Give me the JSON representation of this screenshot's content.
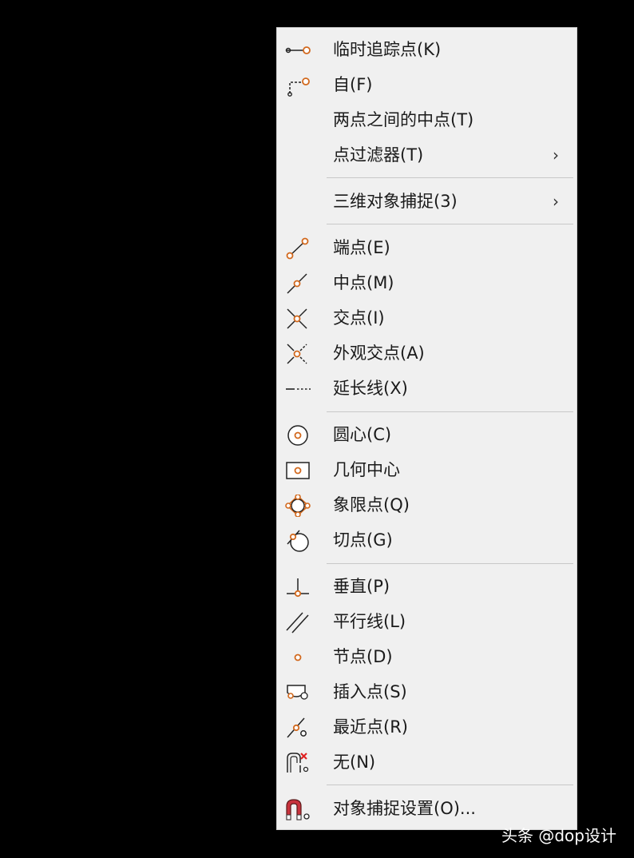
{
  "menu": {
    "items": [
      {
        "label": "临时追踪点(K)",
        "icon": "temporary-track-point-icon"
      },
      {
        "label": "自(F)",
        "icon": "from-icon"
      },
      {
        "label": "两点之间的中点(T)",
        "icon": ""
      },
      {
        "label": "点过滤器(T)",
        "icon": "",
        "submenu": "›"
      },
      {
        "label": "三维对象捕捉(3)",
        "icon": "",
        "submenu": "›"
      },
      {
        "label": "端点(E)",
        "icon": "endpoint-icon"
      },
      {
        "label": "中点(M)",
        "icon": "midpoint-icon"
      },
      {
        "label": "交点(I)",
        "icon": "intersection-icon"
      },
      {
        "label": "外观交点(A)",
        "icon": "apparent-intersection-icon"
      },
      {
        "label": "延长线(X)",
        "icon": "extension-icon"
      },
      {
        "label": "圆心(C)",
        "icon": "center-icon"
      },
      {
        "label": "几何中心",
        "icon": "geometric-center-icon"
      },
      {
        "label": "象限点(Q)",
        "icon": "quadrant-icon"
      },
      {
        "label": "切点(G)",
        "icon": "tangent-icon"
      },
      {
        "label": "垂直(P)",
        "icon": "perpendicular-icon"
      },
      {
        "label": "平行线(L)",
        "icon": "parallel-icon"
      },
      {
        "label": "节点(D)",
        "icon": "node-icon"
      },
      {
        "label": "插入点(S)",
        "icon": "insertion-icon"
      },
      {
        "label": "最近点(R)",
        "icon": "nearest-icon"
      },
      {
        "label": "无(N)",
        "icon": "none-icon"
      },
      {
        "label": "对象捕捉设置(O)...",
        "icon": "osnap-settings-icon"
      }
    ]
  },
  "watermark": "头条 @dop设计",
  "colors": {
    "accent": "#d2691e",
    "menu_bg": "#f0f0f0",
    "separator": "#c8c8c8",
    "text": "#1a1a1a",
    "red": "#e02020"
  }
}
